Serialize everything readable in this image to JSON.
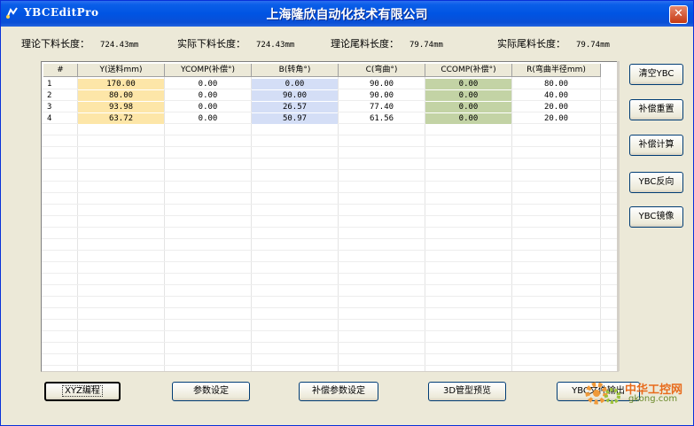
{
  "window": {
    "app_title": "YBCEditPro",
    "company": "上海隆欣自动化技术有限公司",
    "close_glyph": "✕"
  },
  "stats": [
    {
      "label": "理论下料长度：",
      "value": "724.43mm"
    },
    {
      "label": "实际下料长度：",
      "value": "724.43mm"
    },
    {
      "label": "理论尾料长度：",
      "value": "79.74mm"
    },
    {
      "label": "实际尾料长度：",
      "value": "79.74mm"
    }
  ],
  "table": {
    "headers": [
      "#",
      "Y(送料mm)",
      "YCOMP(补偿°)",
      "B(转角°)",
      "C(弯曲°)",
      "CCOMP(补偿°)",
      "R(弯曲半径mm)"
    ],
    "rows": [
      [
        "1",
        "170.00",
        "0.00",
        "0.00",
        "90.00",
        "0.00",
        "80.00"
      ],
      [
        "2",
        "80.00",
        "0.00",
        "90.00",
        "90.00",
        "0.00",
        "40.00"
      ],
      [
        "3",
        "93.98",
        "0.00",
        "26.57",
        "77.40",
        "0.00",
        "20.00"
      ],
      [
        "4",
        "63.72",
        "0.00",
        "50.97",
        "61.56",
        "0.00",
        "20.00"
      ]
    ],
    "highlight_colors": {
      "y": "#fde6a8",
      "b": "#d4def6",
      "ccomp": "#c3d3a5"
    }
  },
  "side_buttons": [
    "清空YBC",
    "补偿重置",
    "补偿计算",
    "YBC反向",
    "YBC镜像"
  ],
  "bottom_buttons": [
    "XYZ编程",
    "参数设定",
    "补偿参数设定",
    "3D管型预览",
    "YBC文件输出"
  ],
  "watermark": {
    "brand": "中华工控网",
    "site": "gkong.com"
  }
}
